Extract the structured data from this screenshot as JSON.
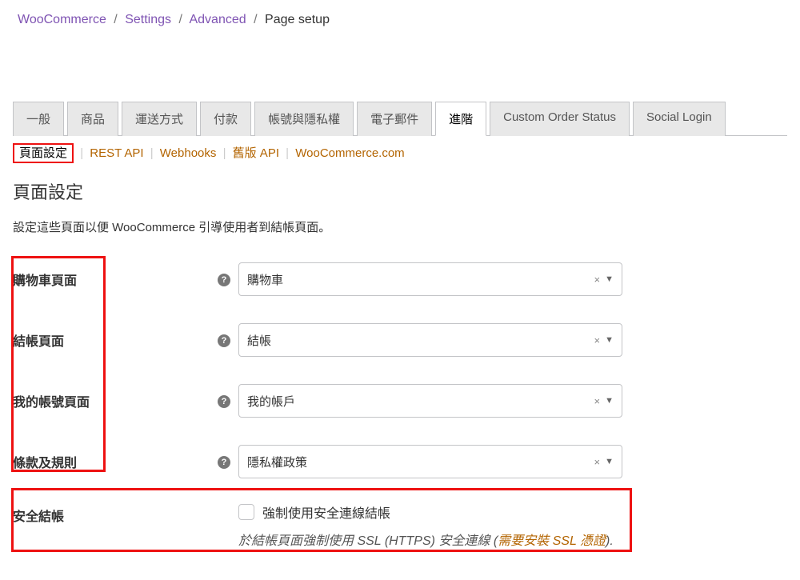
{
  "breadcrumb": {
    "items": [
      "WooCommerce",
      "Settings",
      "Advanced"
    ],
    "current": "Page setup"
  },
  "tabs": {
    "items": [
      "一般",
      "商品",
      "運送方式",
      "付款",
      "帳號與隱私權",
      "電子郵件",
      "進階",
      "Custom Order Status",
      "Social Login"
    ],
    "active_index": 6
  },
  "subtabs": {
    "items": [
      "頁面設定",
      "REST API",
      "Webhooks",
      "舊版 API",
      "WooCommerce.com"
    ],
    "active_index": 0
  },
  "section": {
    "title": "頁面設定",
    "description": "設定這些頁面以便 WooCommerce 引導使用者到結帳頁面。"
  },
  "pageFields": [
    {
      "label": "購物車頁面",
      "value": "購物車"
    },
    {
      "label": "結帳頁面",
      "value": "結帳"
    },
    {
      "label": "我的帳號頁面",
      "value": "我的帳戶"
    },
    {
      "label": "條款及規則",
      "value": "隱私權政策"
    }
  ],
  "secureCheckout": {
    "label": "安全結帳",
    "checkbox_label": "強制使用安全連線結帳",
    "checked": false,
    "description_prefix": "於結帳頁面強制使用 SSL (HTTPS) 安全連線 (",
    "ssl_link_text": "需要安裝 SSL 憑證",
    "description_suffix": ")."
  }
}
